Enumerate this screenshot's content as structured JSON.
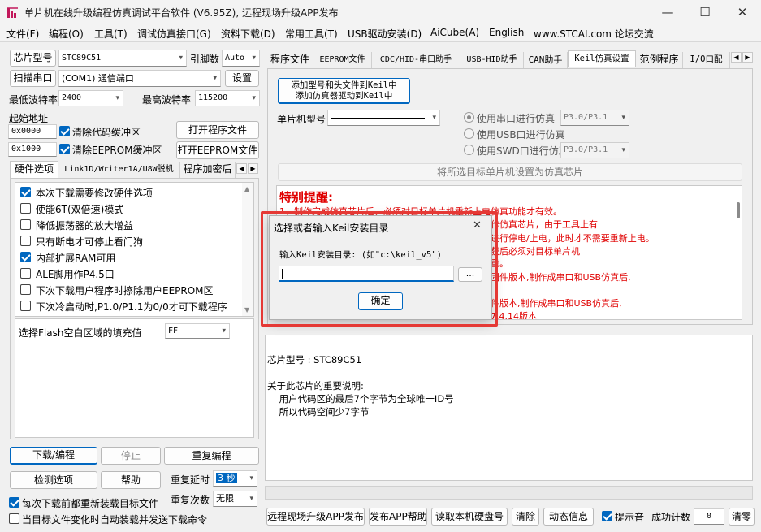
{
  "window": {
    "title": "单片机在线升级编程仿真调试平台软件 (V6.95Z), 远程现场升级APP发布",
    "minimize": "—",
    "maximize": "☐",
    "close": "✕"
  },
  "menu": [
    "文件(F)",
    "编程(O)",
    "工具(T)",
    "调试仿真接口(G)",
    "资料下载(D)",
    "常用工具(T)",
    "USB驱动安装(D)",
    "AiCube(A)",
    "English",
    "www.STCAI.com 论坛交流"
  ],
  "left": {
    "chip_label": "芯片型号",
    "chip_value": "STC89C51",
    "pin_label": "引脚数",
    "pin_value": "Auto",
    "scan_label": "扫描串口",
    "port_value": "(COM1) 通信端口",
    "settings": "设置",
    "min_baud_label": "最低波特率",
    "min_baud": "2400",
    "max_baud_label": "最高波特率",
    "max_baud": "115200",
    "start_addr_label": "起始地址",
    "addr1": "0x0000",
    "clear_code": "清除代码缓冲区",
    "open_program": "打开程序文件",
    "addr2": "0x1000",
    "clear_eeprom": "清除EEPROM缓冲区",
    "open_eeprom": "打开EEPROM文件",
    "tabs": [
      "硬件选项",
      "Link1D/Writer1A/U8W脱机",
      "程序加密后"
    ],
    "options": [
      {
        "label": "本次下载需要修改硬件选项",
        "checked": true
      },
      {
        "label": "使能6T(双倍速)模式",
        "checked": false
      },
      {
        "label": "降低振荡器的放大增益",
        "checked": false
      },
      {
        "label": "只有断电才可停止看门狗",
        "checked": false
      },
      {
        "label": "内部扩展RAM可用",
        "checked": true
      },
      {
        "label": "ALE脚用作P4.5口",
        "checked": false
      },
      {
        "label": "下次下载用户程序时擦除用户EEPROM区",
        "checked": false
      },
      {
        "label": "下次冷启动时,P1.0/P1.1为0/0才可下载程序",
        "checked": false
      }
    ],
    "flash_fill_label": "选择Flash空白区域的填充值",
    "flash_fill_value": "FF",
    "download": "下载/编程",
    "stop": "停止",
    "reprogram": "重复编程",
    "check_options": "检测选项",
    "help": "帮助",
    "repeat_delay_label": "重复延时",
    "repeat_delay": "3 秒",
    "reload_each": "每次下载前都重新装载目标文件",
    "repeat_count_label": "重复次数",
    "repeat_count": "无限",
    "auto_load": "当目标文件变化时自动装载并发送下载命令"
  },
  "right": {
    "tabs": [
      "程序文件",
      "EEPROM文件",
      "CDC/HID-串口助手",
      "USB-HID助手",
      "CAN助手",
      "Keil仿真设置",
      "范例程序",
      "I/O口配"
    ],
    "add_keil_line1": "添加型号和头文件到Keil中",
    "add_keil_line2": "添加仿真器驱动到Keil中",
    "mcu_label": "单片机型号",
    "sim_serial": "使用串口进行仿真",
    "sim_serial_pins": "P3.0/P3.1",
    "sim_usb": "使用USB口进行仿真",
    "sim_swd": "使用SWD口进行仿真",
    "sim_swd_pins": "P3.0/P3.1",
    "set_as_sim": "将所选目标单片机设置为仿真芯片",
    "notice_title": "特别提醒:",
    "notice_lines": [
      "1、制作完成仿真芯片后，必须对目标单片机重新上电仿真功能才有效。",
      "作仿真芯片，由于工具上有",
      "进行停电/上电，此时才不需要重新上电。",
      "获后必须对目标单片机",
      "重。",
      "固件版本,制作成串口和USB仿真后,",
      "",
      "件版本,制作成串口和USB仿真后,",
      "7.4.14版本"
    ],
    "info_lines": [
      "芯片型号 : STC89C51",
      "",
      "关于此芯片的重要说明:",
      "    用户代码区的最后7个字节为全球唯一ID号",
      "    所以代码空间少7字节"
    ]
  },
  "dialog": {
    "title": "选择或者输入Keil安装目录",
    "close": "✕",
    "prompt": "输入Keil安装目录: (如\"c:\\keil_v5\")",
    "input_value": "",
    "browse": "...",
    "ok": "确定"
  },
  "bottom": {
    "remote_upgrade": "远程现场升级APP发布",
    "publish_help": "发布APP帮助",
    "read_disk": "读取本机硬盘号",
    "clear": "清除",
    "dynamic_info": "动态信息",
    "beep": "提示音",
    "success_count_label": "成功计数",
    "success_count": "0",
    "clear_count": "清零"
  }
}
